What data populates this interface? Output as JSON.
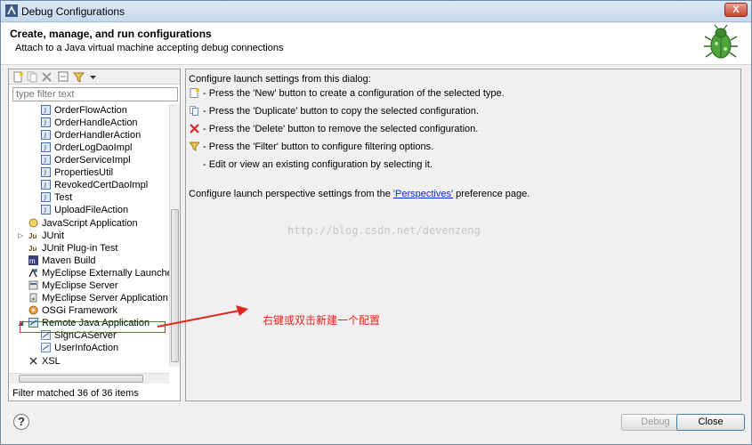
{
  "window": {
    "title": "Debug Configurations",
    "close_label": "X"
  },
  "header": {
    "title": "Create, manage, and run configurations",
    "description": "Attach to a Java virtual machine accepting debug connections"
  },
  "left_panel": {
    "filter_placeholder": "type filter text",
    "tree_items": [
      {
        "label": "OrderFlowAction",
        "icon": "java-class-icon"
      },
      {
        "label": "OrderHandleAction",
        "icon": "java-class-icon"
      },
      {
        "label": "OrderHandlerAction",
        "icon": "java-class-icon"
      },
      {
        "label": "OrderLogDaoImpl",
        "icon": "java-class-icon"
      },
      {
        "label": "OrderServiceImpl",
        "icon": "java-class-icon"
      },
      {
        "label": "PropertiesUtil",
        "icon": "java-class-icon"
      },
      {
        "label": "RevokedCertDaoImpl",
        "icon": "java-class-icon"
      },
      {
        "label": "Test",
        "icon": "java-class-icon"
      },
      {
        "label": "UploadFileAction",
        "icon": "java-class-icon"
      },
      {
        "label": "JavaScript Application",
        "icon": "javascript-app-icon"
      },
      {
        "label": "JUnit",
        "icon": "junit-icon"
      },
      {
        "label": "JUnit Plug-in Test",
        "icon": "junit-plugin-icon"
      },
      {
        "label": "Maven Build",
        "icon": "maven-icon"
      },
      {
        "label": "MyEclipse Externally Launched Ser",
        "icon": "external-launch-icon"
      },
      {
        "label": "MyEclipse Server",
        "icon": "server-icon"
      },
      {
        "label": "MyEclipse Server Application",
        "icon": "server-app-icon"
      },
      {
        "label": "OSGi Framework",
        "icon": "osgi-icon"
      },
      {
        "label": "Remote Java Application",
        "icon": "remote-java-icon"
      },
      {
        "label": "SignCAServer",
        "icon": "remote-config-icon"
      },
      {
        "label": "UserInfoAction",
        "icon": "remote-config-icon"
      },
      {
        "label": "XSL",
        "icon": "xsl-icon"
      }
    ],
    "status": "Filter matched 36 of 36 items"
  },
  "right_panel": {
    "intro": "Configure launch settings from this dialog:",
    "bullets": [
      {
        "text": "- Press the 'New' button to create a configuration of the selected type.",
        "icon": "new-config-icon"
      },
      {
        "text": "- Press the 'Duplicate' button to copy the selected configuration.",
        "icon": "duplicate-icon"
      },
      {
        "text": "- Press the 'Delete' button to remove the selected configuration.",
        "icon": "delete-icon"
      },
      {
        "text": "- Press the 'Filter' button to configure filtering options.",
        "icon": "filter-icon"
      },
      {
        "text": "- Edit or view an existing configuration by selecting it.",
        "icon": ""
      }
    ],
    "perspective_prefix": "Configure launch perspective settings from the ",
    "perspective_link": "'Perspectives'",
    "perspective_suffix": " preference page."
  },
  "watermark": "http://blog.csdn.net/devenzeng",
  "annotation": {
    "text": "右键或双击新建一个配置",
    "color": "#e0271c"
  },
  "buttons": {
    "help": "?",
    "debug": "Debug",
    "close": "Close"
  },
  "colors": {
    "accent": "#3c7fb1",
    "link": "#0033cc",
    "selection_outline": "#dd3333"
  }
}
